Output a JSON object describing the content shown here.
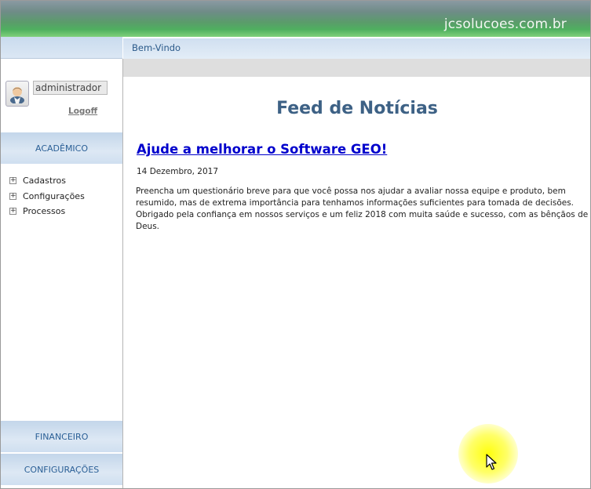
{
  "header": {
    "site": "jcsolucoes.com.br"
  },
  "breadcrumb": "Bem-Vindo",
  "user": {
    "name": "administrador",
    "logoff": "Logoff"
  },
  "sidebar": {
    "sections": {
      "academico": "ACADÊMICO",
      "financeiro": "FINANCEIRO",
      "configuracoes": "CONFIGURAÇÕES"
    },
    "tree": [
      {
        "label": "Cadastros"
      },
      {
        "label": "Configurações"
      },
      {
        "label": "Processos"
      }
    ]
  },
  "main": {
    "title": "Feed de Notícias",
    "news": {
      "title": "Ajude a melhorar o Software GEO!",
      "date": "14 Dezembro, 2017",
      "body": "Preencha um questionário breve para que você possa nos ajudar a avaliar nossa equipe e produto, bem resumido, mas de extrema importância para tenhamos informações suficientes para tomada de decisões. Obrigado pela confiança em nossos serviços e um feliz 2018 com muita saúde e sucesso, com as bênçãos de Deus."
    }
  },
  "colors": {
    "accent": "#3d6185",
    "link": "#0000cc",
    "section_text": "#2a5f96"
  },
  "icons": [
    "user-avatar-icon",
    "expand-plus-icon",
    "mouse-cursor-icon"
  ]
}
